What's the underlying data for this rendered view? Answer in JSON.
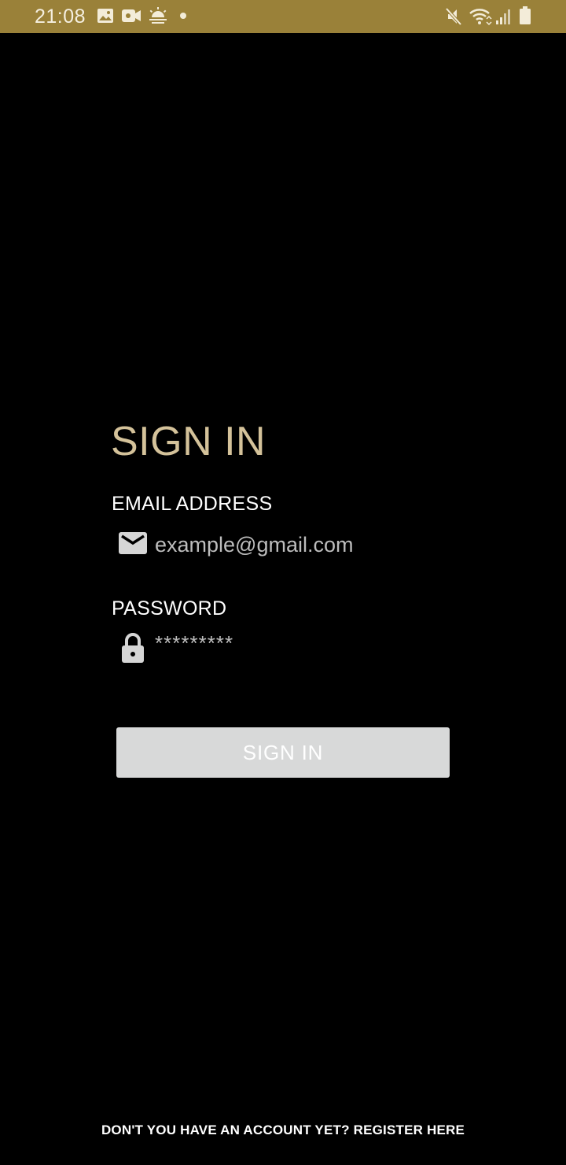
{
  "status_bar": {
    "time": "21:08",
    "background": "#9a8139",
    "left_icons": [
      "image-icon",
      "video-camera-icon",
      "weather-icon",
      "notification-dot-icon"
    ],
    "right_icons": [
      "mute-icon",
      "wifi-icon",
      "signal-icon",
      "battery-icon"
    ]
  },
  "form": {
    "title": "SIGN IN",
    "title_color": "#d4c29a",
    "email": {
      "label": "EMAIL ADDRESS",
      "placeholder": "example@gmail.com",
      "icon": "mail-icon"
    },
    "password": {
      "label": "PASSWORD",
      "placeholder": "*********",
      "icon": "lock-icon"
    },
    "submit_label": "SIGN IN",
    "submit_color": "#d8d9d9"
  },
  "footer": {
    "register_text": "DON'T YOU HAVE AN ACCOUNT YET? REGISTER HERE"
  }
}
